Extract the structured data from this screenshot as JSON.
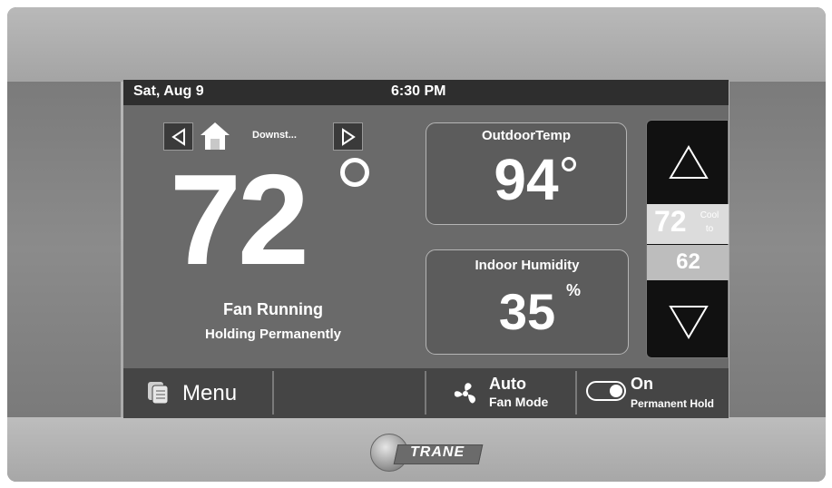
{
  "status_bar": {
    "date": "Sat, Aug 9",
    "time": "6:30 PM"
  },
  "zone": {
    "name": "Downst..."
  },
  "current_temp": {
    "value": "72"
  },
  "status": {
    "fan": "Fan Running",
    "hold": "Holding Permanently"
  },
  "outdoor": {
    "label": "OutdoorTemp",
    "value": "94"
  },
  "humidity": {
    "label": "Indoor Humidity",
    "value": "35",
    "unit": "%"
  },
  "setpoints": {
    "cool_value": "72",
    "cool_label": "Cool to",
    "heat_value": "62"
  },
  "bottom_bar": {
    "menu_label": "Menu",
    "fan_mode_value": "Auto",
    "fan_mode_label": "Fan Mode",
    "hold_value": "On",
    "hold_label": "Permanent Hold"
  },
  "brand": {
    "logo_text": "TRANE"
  },
  "colors": {
    "screen_bg": "#6a6a6a",
    "status_bar_bg": "#2e2e2e",
    "bezel": "#a8a8a8",
    "setpoint_panel": "#111111"
  }
}
